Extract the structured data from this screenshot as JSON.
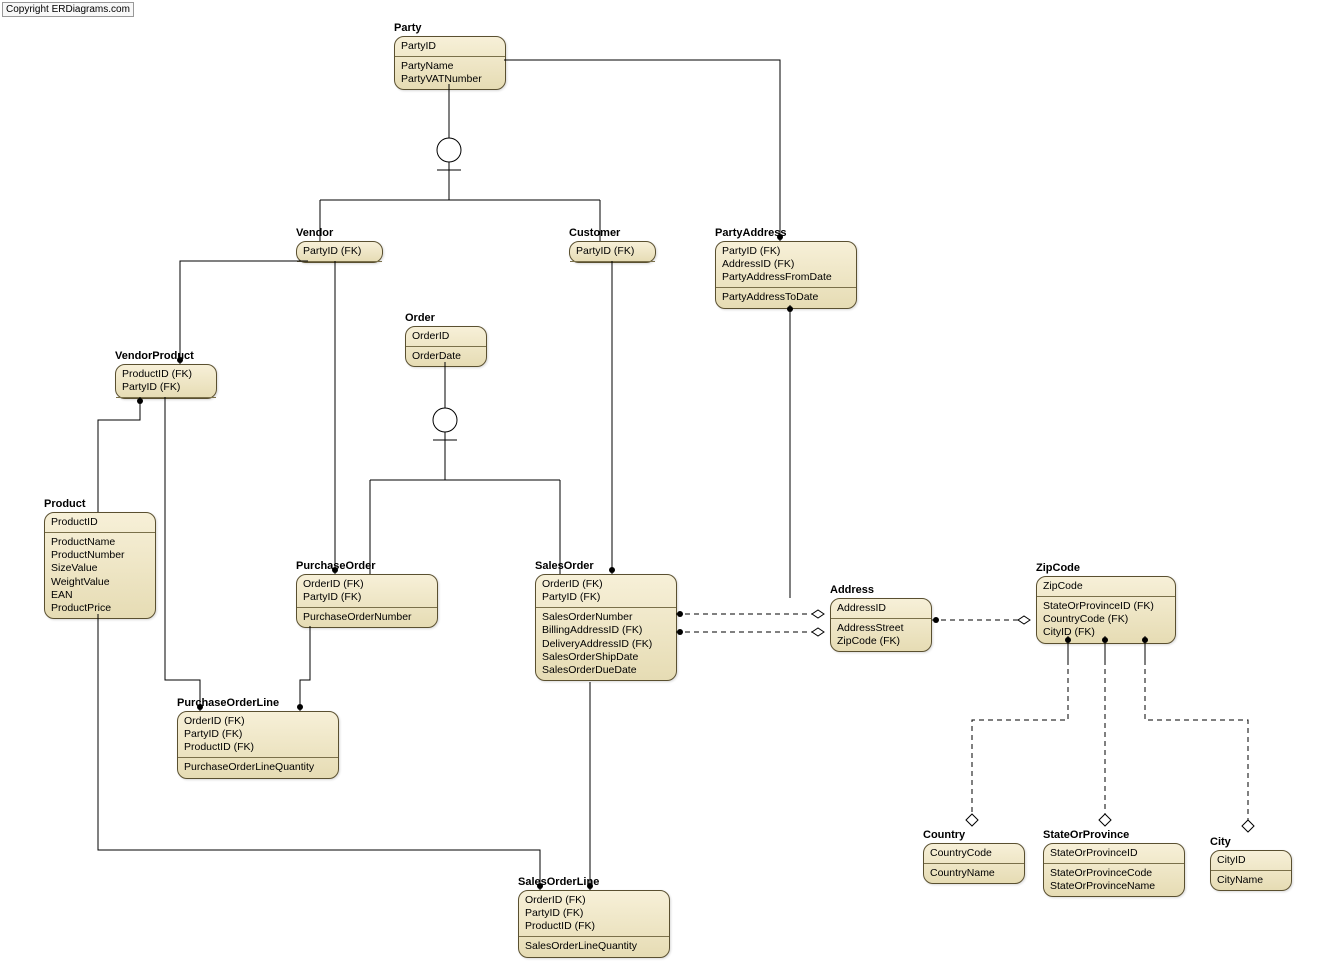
{
  "copyright": "Copyright ERDiagrams.com",
  "entities": {
    "party": {
      "title": "Party",
      "keys": [
        "PartyID"
      ],
      "attrs": [
        "PartyName",
        "PartyVATNumber"
      ]
    },
    "vendor": {
      "title": "Vendor",
      "keys": [
        "PartyID (FK)"
      ],
      "attrs": []
    },
    "customer": {
      "title": "Customer",
      "keys": [
        "PartyID (FK)"
      ],
      "attrs": []
    },
    "partyaddress": {
      "title": "PartyAddress",
      "keys": [
        "PartyID (FK)",
        "AddressID (FK)",
        "PartyAddressFromDate"
      ],
      "attrs": [
        "PartyAddressToDate"
      ]
    },
    "order": {
      "title": "Order",
      "keys": [
        "OrderID"
      ],
      "attrs": [
        "OrderDate"
      ]
    },
    "vendorproduct": {
      "title": "VendorProduct",
      "keys": [
        "ProductID (FK)",
        "PartyID (FK)"
      ],
      "attrs": []
    },
    "product": {
      "title": "Product",
      "keys": [
        "ProductID"
      ],
      "attrs": [
        "ProductName",
        "ProductNumber",
        "SizeValue",
        "WeightValue",
        "EAN",
        "ProductPrice"
      ]
    },
    "purchaseorder": {
      "title": "PurchaseOrder",
      "keys": [
        "OrderID (FK)",
        "PartyID (FK)"
      ],
      "attrs": [
        "PurchaseOrderNumber"
      ]
    },
    "salesorder": {
      "title": "SalesOrder",
      "keys": [
        "OrderID (FK)",
        "PartyID (FK)"
      ],
      "attrs": [
        "SalesOrderNumber",
        "BillingAddressID (FK)",
        "DeliveryAddressID (FK)",
        "SalesOrderShipDate",
        "SalesOrderDueDate"
      ]
    },
    "purchaseorderline": {
      "title": "PurchaseOrderLine",
      "keys": [
        "OrderID (FK)",
        "PartyID (FK)",
        "ProductID (FK)"
      ],
      "attrs": [
        "PurchaseOrderLineQuantity"
      ]
    },
    "salesorderline": {
      "title": "SalesOrderLine",
      "keys": [
        "OrderID (FK)",
        "PartyID (FK)",
        "ProductID (FK)"
      ],
      "attrs": [
        "SalesOrderLineQuantity"
      ]
    },
    "address": {
      "title": "Address",
      "keys": [
        "AddressID"
      ],
      "attrs": [
        "AddressStreet",
        "ZipCode (FK)"
      ]
    },
    "zipcode": {
      "title": "ZipCode",
      "keys": [
        "ZipCode"
      ],
      "attrs": [
        "StateOrProvinceID (FK)",
        "CountryCode (FK)",
        "CityID (FK)"
      ]
    },
    "country": {
      "title": "Country",
      "keys": [
        "CountryCode"
      ],
      "attrs": [
        "CountryName"
      ]
    },
    "stateorprovince": {
      "title": "StateOrProvince",
      "keys": [
        "StateOrProvinceID"
      ],
      "attrs": [
        "StateOrProvinceCode",
        "StateOrProvinceName"
      ]
    },
    "city": {
      "title": "City",
      "keys": [
        "CityID"
      ],
      "attrs": [
        "CityName"
      ]
    }
  }
}
